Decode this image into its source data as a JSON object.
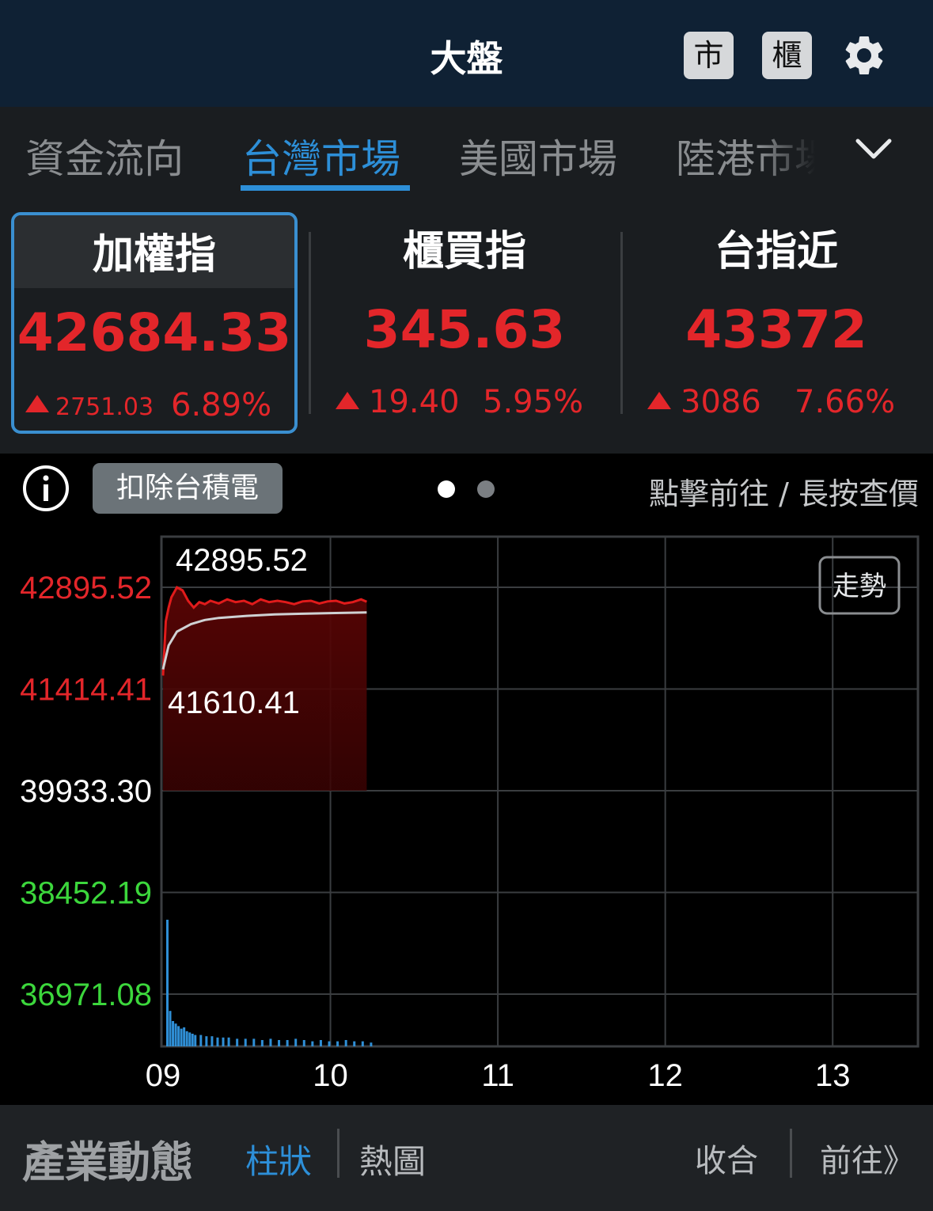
{
  "header": {
    "title": "大盤",
    "btn_market": "市",
    "btn_otc": "櫃",
    "settings_icon": "gear-icon"
  },
  "tabs": [
    {
      "label": "資金流向",
      "active": false
    },
    {
      "label": "台灣市場",
      "active": true
    },
    {
      "label": "美國市場",
      "active": false
    },
    {
      "label": "陸港市場",
      "active": false
    }
  ],
  "tabs_dropdown_icon": "chevron-down-icon",
  "cards": [
    {
      "name": "加權指",
      "value": "42684.33",
      "change": "2751.03",
      "percent": "6.89%",
      "selected": true
    },
    {
      "name": "櫃買指",
      "value": "345.63",
      "change": "19.40",
      "percent": "5.95%",
      "selected": false
    },
    {
      "name": "台指近",
      "value": "43372",
      "change": "3086",
      "percent": "7.66%",
      "selected": false
    }
  ],
  "infobar": {
    "info_icon": "info-icon",
    "exclude_button": "扣除台積電",
    "hint": "點擊前往 / 長按查價",
    "page": 1,
    "pages": 2
  },
  "colors": {
    "up": "#e3262a",
    "down": "#3cd73c",
    "accent": "#2d8fd8",
    "volume": "#2f8fd6",
    "header_bg": "#0f2134"
  },
  "chart_data": {
    "type": "line",
    "toggle_label": "走勢",
    "ylim": [
      36212,
      42895.52
    ],
    "y_ticks": [
      {
        "label": "42895.52",
        "value": 42895.52,
        "color": "up"
      },
      {
        "label": "41414.41",
        "value": 41414.41,
        "color": "up"
      },
      {
        "label": "39933.30",
        "value": 39933.3,
        "color": "neutral"
      },
      {
        "label": "38452.19",
        "value": 38452.19,
        "color": "down"
      },
      {
        "label": "36971.08",
        "value": 36971.08,
        "color": "down"
      }
    ],
    "x_ticks": [
      "09",
      "10",
      "11",
      "12",
      "13"
    ],
    "reference_close": 39933.3,
    "high_label": "42895.52",
    "low_label": "41610.41",
    "series": [
      {
        "role": "price",
        "x": [
          "09:00",
          "09:01",
          "09:02",
          "09:03",
          "09:05",
          "09:07",
          "09:09",
          "09:11",
          "09:13",
          "09:15",
          "09:17",
          "09:20",
          "09:23",
          "09:26",
          "09:29",
          "09:32",
          "09:35",
          "09:38",
          "09:41",
          "09:44",
          "09:47",
          "09:50",
          "09:53",
          "09:56",
          "09:59",
          "10:02",
          "10:05",
          "10:08",
          "10:11",
          "10:13"
        ],
        "values": [
          41610.41,
          42400,
          42600,
          42750,
          42895.52,
          42850,
          42700,
          42600,
          42680,
          42650,
          42700,
          42660,
          42720,
          42680,
          42700,
          42650,
          42720,
          42680,
          42700,
          42680,
          42650,
          42690,
          42700,
          42660,
          42690,
          42700,
          42660,
          42680,
          42720,
          42684.33
        ]
      },
      {
        "role": "average",
        "x": [
          "09:00",
          "09:02",
          "09:05",
          "09:10",
          "09:15",
          "09:20",
          "09:30",
          "09:40",
          "09:50",
          "10:00",
          "10:13"
        ],
        "values": [
          41700,
          42050,
          42250,
          42360,
          42420,
          42450,
          42480,
          42500,
          42510,
          42520,
          42530
        ]
      }
    ],
    "volume": {
      "x_minutes": [
        0,
        1,
        2,
        3,
        4,
        5,
        6,
        7,
        8,
        9,
        10,
        12,
        14,
        16,
        18,
        20,
        22,
        25,
        28,
        31,
        34,
        37,
        40,
        43,
        46,
        49,
        52,
        55,
        58,
        61,
        64,
        67,
        70,
        73
      ],
      "values": [
        100,
        28,
        20,
        18,
        16,
        14,
        15,
        12,
        11,
        10,
        9,
        9,
        8,
        8,
        7,
        7,
        7,
        6,
        6,
        6,
        5,
        6,
        5,
        5,
        6,
        5,
        4,
        5,
        4,
        4,
        5,
        4,
        4,
        3
      ]
    }
  },
  "bottom": {
    "title": "產業動態",
    "tab_bar": "柱狀",
    "tab_heat": "熱圖",
    "collapse": "收合",
    "goto": "前往》"
  }
}
